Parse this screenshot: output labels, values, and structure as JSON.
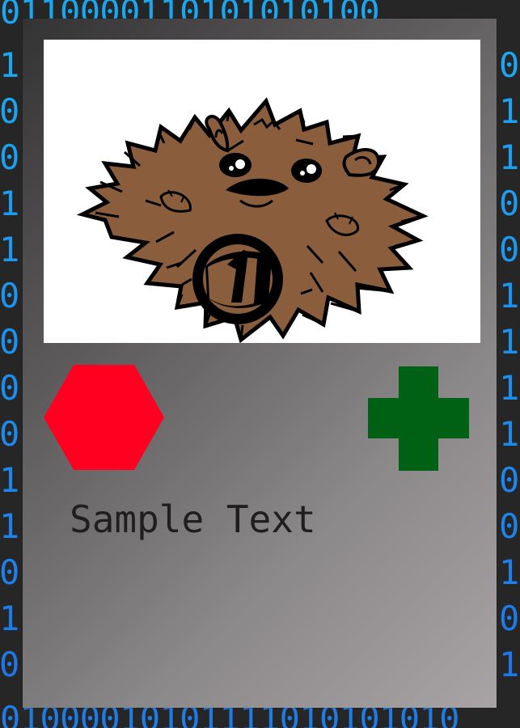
{
  "background": {
    "binary_top": "0110000110101010100",
    "binary_bottom": "01000010101111010101010",
    "binary_left": "1\n0\n0\n1\n1\n0\n0\n0\n0\n1\n1\n0\n1\n0",
    "binary_right": "0\n1\n1\n0\n0\n1\n1\n1\n1\n0\n0\n1\n0\n1",
    "colors": {
      "page": "#262626",
      "binary": "#1aa7f2"
    }
  },
  "card": {
    "gradient_start": "#343334",
    "gradient_end": "#a8a3a4",
    "illustration": "hedgehog-illustration",
    "badge_text": "1",
    "red_shape": "hexagon",
    "green_shape": "plus",
    "shape_colors": {
      "hexagon": "#ff0021",
      "plus": "#006114"
    },
    "text": "Sample Text"
  }
}
